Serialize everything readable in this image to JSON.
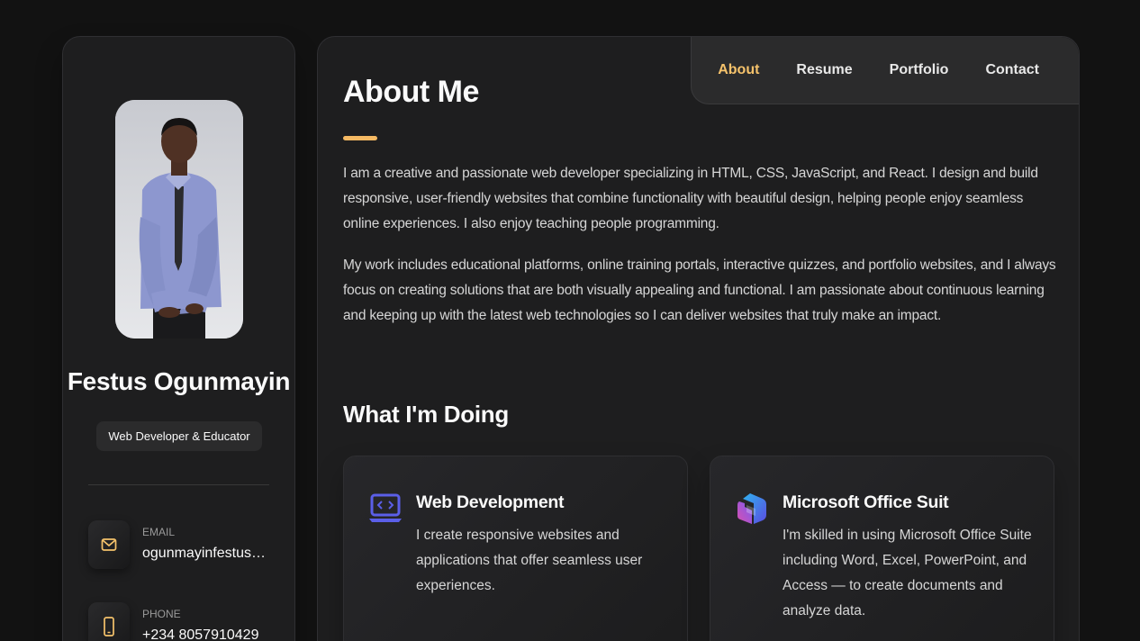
{
  "profile": {
    "name": "Festus Ogunmayin",
    "title": "Web Developer & Educator"
  },
  "contacts": [
    {
      "label": "EMAIL",
      "value": "ogunmayinfestus@...",
      "icon": "mail-icon"
    },
    {
      "label": "PHONE",
      "value": "+234 8057910429",
      "icon": "phone-icon"
    }
  ],
  "nav": {
    "items": [
      {
        "label": "About",
        "active": true
      },
      {
        "label": "Resume",
        "active": false
      },
      {
        "label": "Portfolio",
        "active": false
      },
      {
        "label": "Contact",
        "active": false
      }
    ]
  },
  "about": {
    "heading": "About Me",
    "paragraphs": [
      "I am a creative and passionate web developer specializing in HTML, CSS, JavaScript, and React. I design and build responsive, user-friendly websites that combine functionality with beautiful design, helping people enjoy seamless online experiences. I also enjoy teaching people programming.",
      "My work includes educational platforms, online training portals, interactive quizzes, and portfolio websites, and I always focus on creating solutions that are both visually appealing and functional. I am passionate about continuous learning and keeping up with the latest web technologies so I can deliver websites that truly make an impact."
    ]
  },
  "services": {
    "heading": "What I'm Doing",
    "items": [
      {
        "title": "Web Development",
        "description": "I create responsive websites and applications that offer seamless user experiences.",
        "icon": "laptop-code-icon"
      },
      {
        "title": "Microsoft Office Suit",
        "description": "I'm skilled in using Microsoft Office Suite including Word, Excel, PowerPoint, and Access — to create documents and analyze data.",
        "icon": "microsoft-office-icon"
      }
    ]
  },
  "colors": {
    "accent": "#f5c26b",
    "background": "#121212",
    "panel": "#1e1e1f"
  }
}
